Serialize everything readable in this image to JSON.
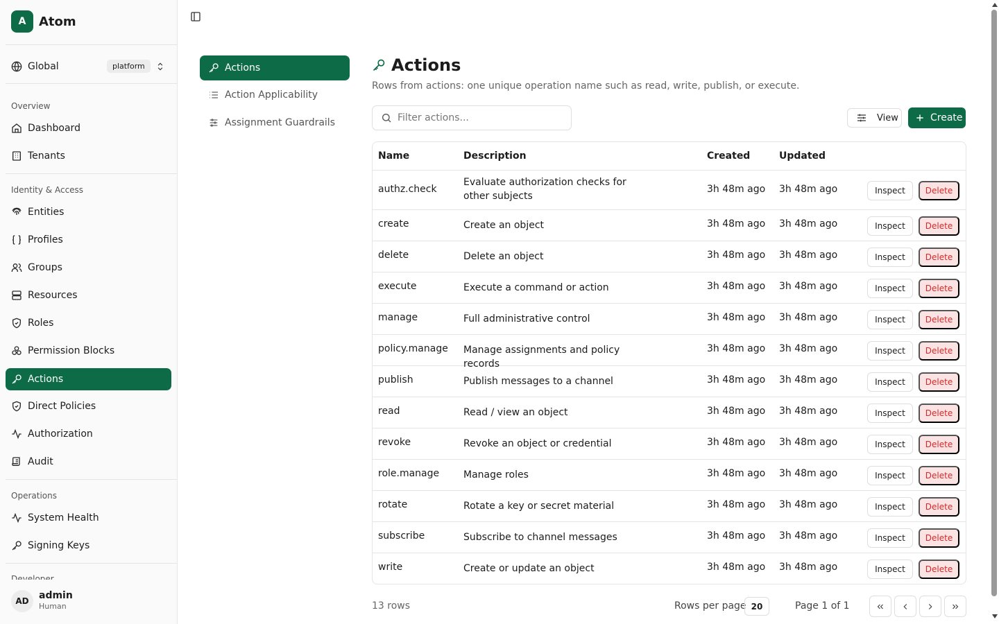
{
  "app": {
    "logo_letter": "A",
    "name": "Atom"
  },
  "scope": {
    "label": "Global",
    "badge": "platform"
  },
  "sidebar": {
    "sections": [
      {
        "title": "Overview",
        "items": [
          {
            "label": "Dashboard",
            "icon": "home-icon"
          },
          {
            "label": "Tenants",
            "icon": "building-icon"
          }
        ]
      },
      {
        "title": "Identity & Access",
        "items": [
          {
            "label": "Entities",
            "icon": "fingerprint-icon"
          },
          {
            "label": "Profiles",
            "icon": "braces-icon"
          },
          {
            "label": "Groups",
            "icon": "users-icon"
          },
          {
            "label": "Resources",
            "icon": "server-icon"
          },
          {
            "label": "Roles",
            "icon": "shield-icon"
          },
          {
            "label": "Permission Blocks",
            "icon": "blocks-icon"
          },
          {
            "label": "Actions",
            "icon": "key-icon",
            "active": true
          },
          {
            "label": "Direct Policies",
            "icon": "shield-icon"
          },
          {
            "label": "Authorization",
            "icon": "activity-icon"
          },
          {
            "label": "Audit",
            "icon": "scroll-icon"
          }
        ]
      },
      {
        "title": "Operations",
        "items": [
          {
            "label": "System Health",
            "icon": "activity-icon"
          },
          {
            "label": "Signing Keys",
            "icon": "key-icon"
          }
        ]
      },
      {
        "title": "Developer"
      }
    ]
  },
  "user": {
    "initials": "AD",
    "name": "admin",
    "role": "Human"
  },
  "subnav": [
    {
      "label": "Actions",
      "icon": "key-icon",
      "active": true
    },
    {
      "label": "Action Applicability",
      "icon": "list-icon"
    },
    {
      "label": "Assignment Guardrails",
      "icon": "sliders-icon"
    }
  ],
  "page": {
    "title": "Actions",
    "description": "Rows from actions: one unique operation name such as read, write, publish, or execute.",
    "search_placeholder": "Filter actions...",
    "view_label": "View",
    "create_label": "Create"
  },
  "table": {
    "headers": {
      "name": "Name",
      "description": "Description",
      "created": "Created",
      "updated": "Updated"
    },
    "inspect_label": "Inspect",
    "delete_label": "Delete",
    "rows": [
      {
        "name": "authz.check",
        "description": "Evaluate authorization checks for other subjects",
        "created": "3h 48m ago",
        "updated": "3h 48m ago"
      },
      {
        "name": "create",
        "description": "Create an object",
        "created": "3h 48m ago",
        "updated": "3h 48m ago"
      },
      {
        "name": "delete",
        "description": "Delete an object",
        "created": "3h 48m ago",
        "updated": "3h 48m ago"
      },
      {
        "name": "execute",
        "description": "Execute a command or action",
        "created": "3h 48m ago",
        "updated": "3h 48m ago"
      },
      {
        "name": "manage",
        "description": "Full administrative control",
        "created": "3h 48m ago",
        "updated": "3h 48m ago"
      },
      {
        "name": "policy.manage",
        "description": "Manage assignments and policy records",
        "created": "3h 48m ago",
        "updated": "3h 48m ago"
      },
      {
        "name": "publish",
        "description": "Publish messages to a channel",
        "created": "3h 48m ago",
        "updated": "3h 48m ago"
      },
      {
        "name": "read",
        "description": "Read / view an object",
        "created": "3h 48m ago",
        "updated": "3h 48m ago"
      },
      {
        "name": "revoke",
        "description": "Revoke an object or credential",
        "created": "3h 48m ago",
        "updated": "3h 48m ago"
      },
      {
        "name": "role.manage",
        "description": "Manage roles",
        "created": "3h 48m ago",
        "updated": "3h 48m ago"
      },
      {
        "name": "rotate",
        "description": "Rotate a key or secret material",
        "created": "3h 48m ago",
        "updated": "3h 48m ago"
      },
      {
        "name": "subscribe",
        "description": "Subscribe to channel messages",
        "created": "3h 48m ago",
        "updated": "3h 48m ago"
      },
      {
        "name": "write",
        "description": "Create or update an object",
        "created": "3h 48m ago",
        "updated": "3h 48m ago"
      }
    ]
  },
  "footer": {
    "row_count": "13 rows",
    "rows_per_page_label": "Rows per page",
    "rows_per_page": "20",
    "page_label": "Page 1 of 1"
  },
  "colors": {
    "accent": "#0e6b47",
    "danger": "#d62828",
    "danger_bg": "#fbe3e3"
  }
}
